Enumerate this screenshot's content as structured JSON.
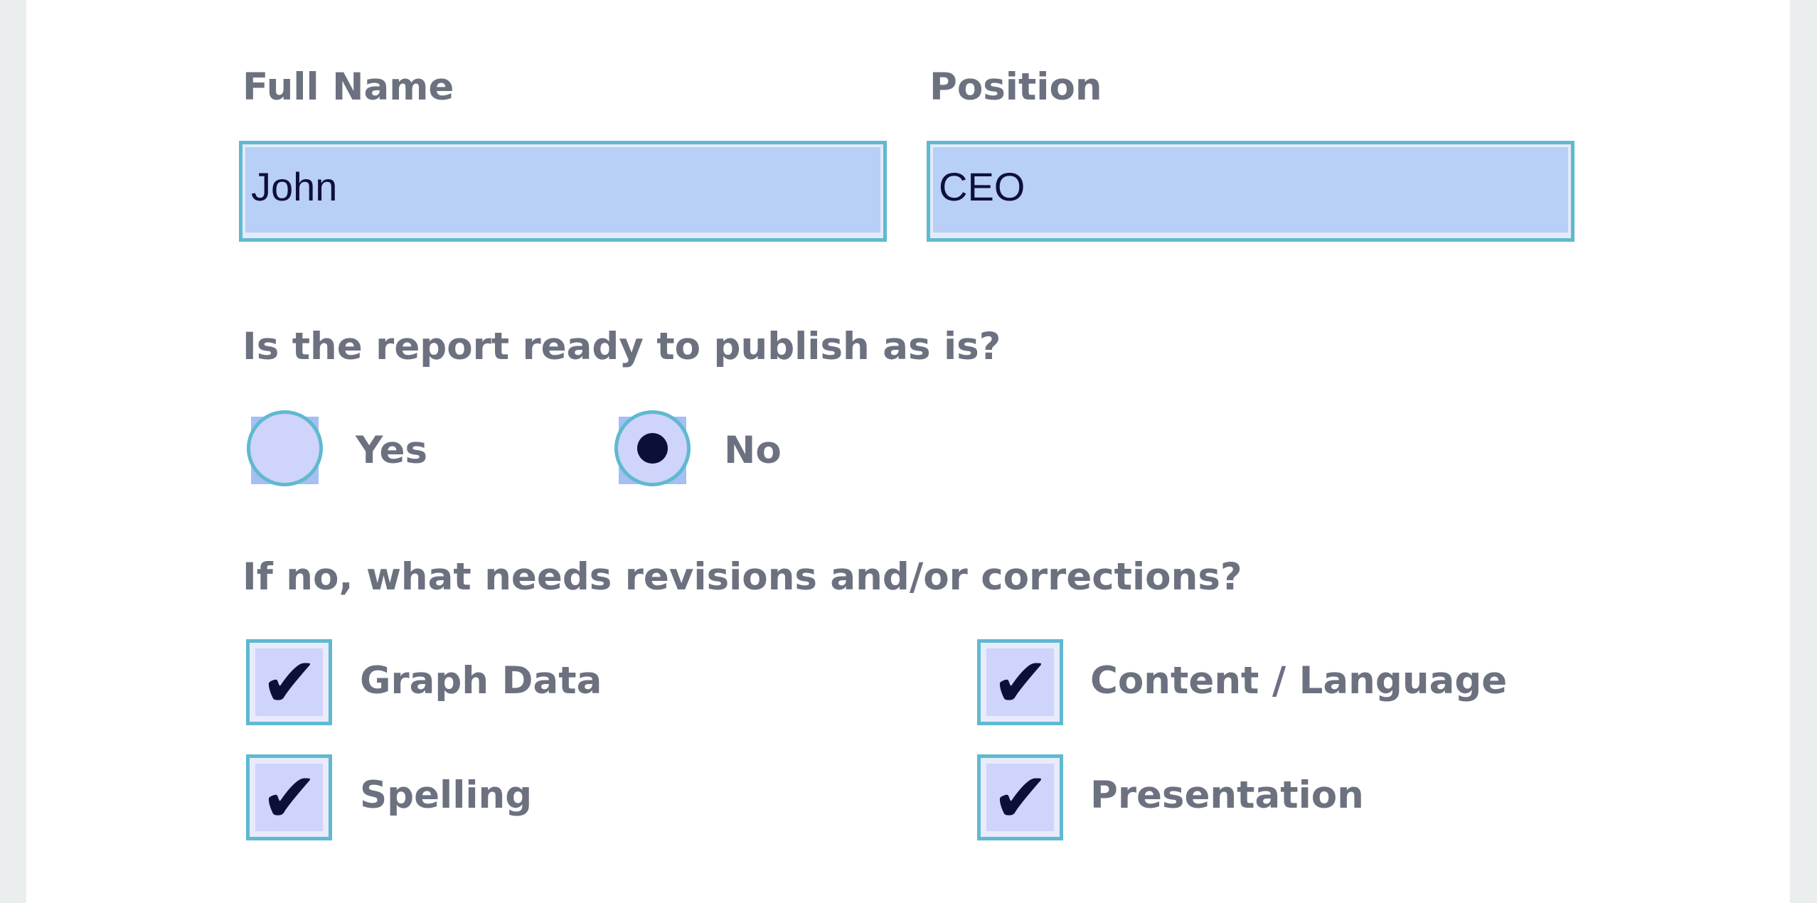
{
  "form": {
    "full_name": {
      "label": "Full Name",
      "value": "John"
    },
    "position": {
      "label": "Position",
      "value": "CEO"
    },
    "publish_question": {
      "label": "Is the report ready to publish as is?",
      "options": [
        {
          "label": "Yes",
          "selected": false
        },
        {
          "label": "No",
          "selected": true
        }
      ]
    },
    "revisions_question": {
      "label": "If no, what needs revisions and/or corrections?",
      "options": [
        {
          "label": "Graph Data",
          "checked": true
        },
        {
          "label": "Content / Language",
          "checked": true
        },
        {
          "label": "Spelling",
          "checked": true
        },
        {
          "label": "Presentation",
          "checked": true
        }
      ],
      "check_glyph": "✔"
    }
  },
  "colors": {
    "field_border": "#5fb9d0",
    "field_fill": "#b8cff7",
    "label_text": "#6c7180",
    "value_text": "#0e0f3a"
  }
}
